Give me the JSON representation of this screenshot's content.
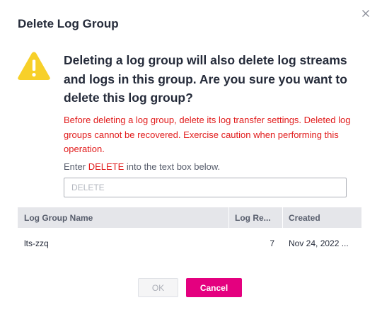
{
  "dialog": {
    "title": "Delete Log Group",
    "close_icon": "close-icon",
    "warning_icon": "warning-triangle-icon",
    "headline": "Deleting a log group will also delete log streams and logs in this group. Are you sure you want to delete this log group?",
    "danger_text": "Before deleting a log group, delete its log transfer settings. Deleted log groups cannot be recovered. Exercise caution when performing this operation.",
    "instruction": {
      "before": "Enter ",
      "keyword": "DELETE",
      "after": " into the text box below."
    },
    "confirm_input": {
      "value": "",
      "placeholder": "DELETE"
    },
    "table": {
      "headers": [
        "Log Group Name",
        "Log Re...",
        "Created"
      ],
      "rows": [
        [
          "lts-zzq",
          "7",
          "Nov 24, 2022 ..."
        ]
      ]
    },
    "buttons": {
      "ok": "OK",
      "cancel": "Cancel"
    }
  },
  "colors": {
    "accent": "#e4007f",
    "danger": "#e11b1b",
    "warning": "#f7d029",
    "table_header_bg": "#e5e6ea"
  }
}
